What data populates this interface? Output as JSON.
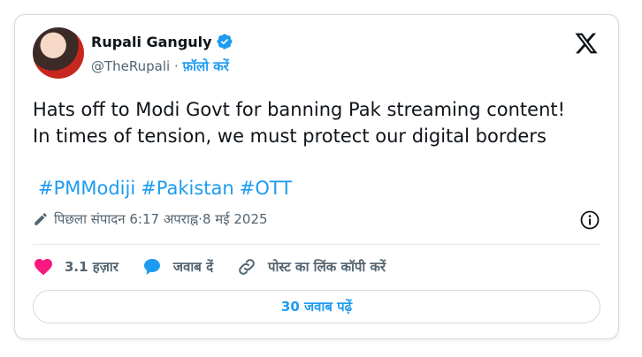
{
  "author": {
    "display_name": "Rupali Ganguly",
    "handle": "@TheRupali",
    "separator": " · ",
    "follow_label": "फ़ॉलो करें",
    "verified_color": "#1d9bf0"
  },
  "tweet": {
    "lines": [
      "Hats off to Modi Govt for banning Pak streaming content!",
      "In times of tension, we must protect our digital borders"
    ],
    "hashtags": [
      "#PMModiji",
      "#Pakistan",
      "#OTT"
    ]
  },
  "meta": {
    "edited_label": "पिछला संपादन",
    "time": "6:17 अपराह्न",
    "separator": " · ",
    "date": "8 मई 2025"
  },
  "actions": {
    "like_count": "3.1 हज़ार",
    "reply_label": "जवाब दें",
    "copy_link_label": "पोस्ट का लिंक कॉपी करें"
  },
  "replies_button": {
    "label": "30 जवाब पढ़ें"
  },
  "icons": [
    "x-logo-icon",
    "verified-badge-icon",
    "pencil-icon",
    "info-icon",
    "heart-icon",
    "reply-bubble-icon",
    "link-icon"
  ],
  "colors": {
    "accent": "#1d9bf0",
    "like": "#f91880",
    "text": "#0f1419",
    "muted": "#536471"
  }
}
